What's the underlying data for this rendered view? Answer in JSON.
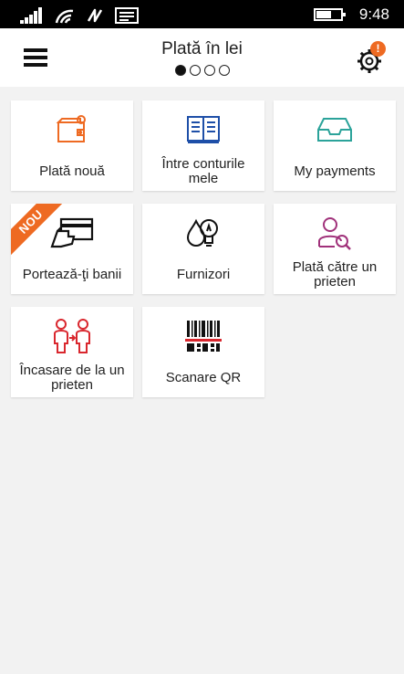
{
  "status_bar": {
    "time": "9:48",
    "icons": [
      "signal-icon",
      "wifi-icon",
      "nfc-icon",
      "message-icon",
      "battery-icon"
    ]
  },
  "header": {
    "title": "Plată în lei",
    "page_indicator": {
      "total": 4,
      "active": 1
    },
    "settings_badge": "!"
  },
  "colors": {
    "accent": "#ee6a22",
    "blue": "#1e4fa8",
    "teal": "#2ba39a",
    "purple": "#a0317a",
    "red": "#d9272e"
  },
  "tiles": [
    {
      "label": "Plată nouă",
      "icon": "wallet-icon"
    },
    {
      "label": "Între conturile mele",
      "icon": "book-icon"
    },
    {
      "label": "My payments",
      "icon": "inbox-tray-icon"
    },
    {
      "label": "Portează-ţi banii",
      "icon": "card-hand-icon",
      "ribbon": "NOU"
    },
    {
      "label": "Furnizori",
      "icon": "utilities-icon"
    },
    {
      "label": "Plată către un prieten",
      "icon": "friend-search-icon"
    },
    {
      "label": "Încasare de la un prieten",
      "icon": "people-transfer-icon"
    },
    {
      "label": "Scanare QR",
      "icon": "barcode-icon"
    }
  ]
}
